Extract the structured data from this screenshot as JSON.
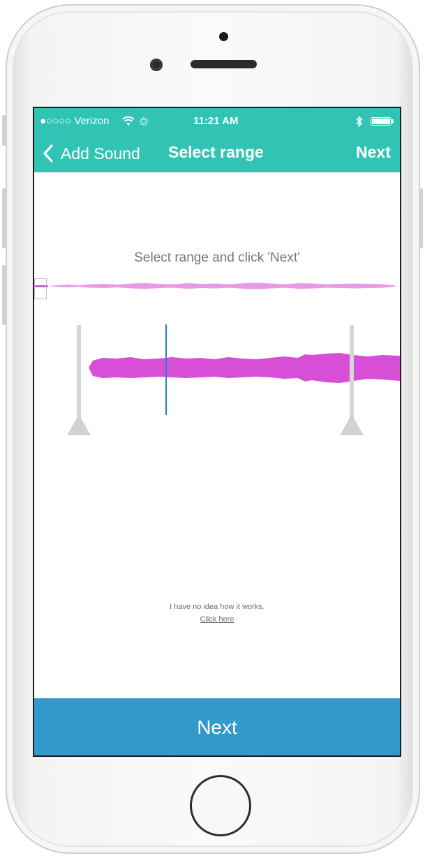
{
  "status_bar": {
    "carrier": "●○○○○ Verizon",
    "wifi_icon": "wifi-icon",
    "activity_icon": "activity-spinner-icon",
    "time": "11:21 AM",
    "bluetooth_icon": "bluetooth-icon",
    "battery_icon": "battery-icon"
  },
  "nav": {
    "back_label": "Add Sound",
    "title": "Select range",
    "next_label": "Next"
  },
  "content": {
    "instruction": "Select range and click 'Next'",
    "help_text": "I have no idea how it works.",
    "help_link": "Click here"
  },
  "footer": {
    "next_label": "Next"
  },
  "colors": {
    "header": "#31c4b5",
    "waveform": "#d64fd6",
    "waveform_overview": "#e79be6",
    "playhead": "#1f7fe0",
    "footer_button": "#3399cc",
    "handle": "#d4d4d4"
  }
}
